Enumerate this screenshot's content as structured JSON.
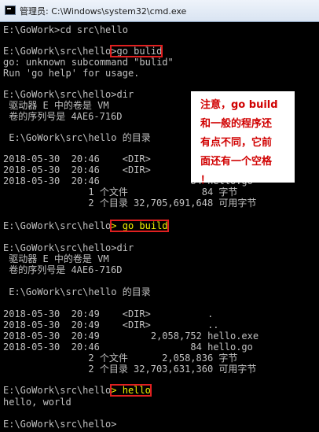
{
  "window": {
    "title": "管理员: C:\\Windows\\system32\\cmd.exe"
  },
  "colors": {
    "console_bg": "#000000",
    "console_text": "#c0c0c0",
    "typed_command": "#f0f000",
    "highlight_box": "#e02020",
    "note_text": "#d00000"
  },
  "console": {
    "l1_prompt": "E:\\GoWork>",
    "l1_cmd": "cd src\\hello",
    "l2_prompt": "E:\\GoWork\\src\\hello",
    "l2_cmd": ">go bulid",
    "l3": "go: unknown subcommand \"bulid\"",
    "l4": "Run 'go help' for usage.",
    "l5_prompt": "E:\\GoWork\\src\\hello",
    "l5_cmd": ">dir",
    "l6": " 驱动器 E 中的卷是 VM",
    "l7": " 卷的序列号是 4AE6-716D",
    "l8": " E:\\GoWork\\src\\hello 的目录",
    "l9": "2018-05-30  20:46    <DIR>          .",
    "l10": "2018-05-30  20:46    <DIR>          ..",
    "l11": "2018-05-30  20:46                84 hello.go",
    "l12": "               1 个文件             84 字节",
    "l13": "               2 个目录 32,705,691,648 可用字节",
    "l14_prompt": "E:\\GoWork\\src\\hello",
    "l14_cmd": "> go build",
    "l15_prompt": "E:\\GoWork\\src\\hello",
    "l15_cmd": ">dir",
    "l16": " 驱动器 E 中的卷是 VM",
    "l17": " 卷的序列号是 4AE6-716D",
    "l18": " E:\\GoWork\\src\\hello 的目录",
    "l19": "2018-05-30  20:49    <DIR>          .",
    "l20": "2018-05-30  20:49    <DIR>          ..",
    "l21": "2018-05-30  20:49         2,058,752 hello.exe",
    "l22": "2018-05-30  20:46                84 hello.go",
    "l23": "               2 个文件      2,058,836 字节",
    "l24": "               2 个目录 32,703,631,360 可用字节",
    "l25_prompt": "E:\\GoWork\\src\\hello",
    "l25_cmd": "> hello",
    "l26": "hello, world",
    "l27": "E:\\GoWork\\src\\hello>"
  },
  "annotation": {
    "line1": "注意，go build",
    "line2": "和一般的程序还",
    "line3": "有点不同，它前",
    "line4": "面还有一个空格",
    "line5": "！"
  }
}
